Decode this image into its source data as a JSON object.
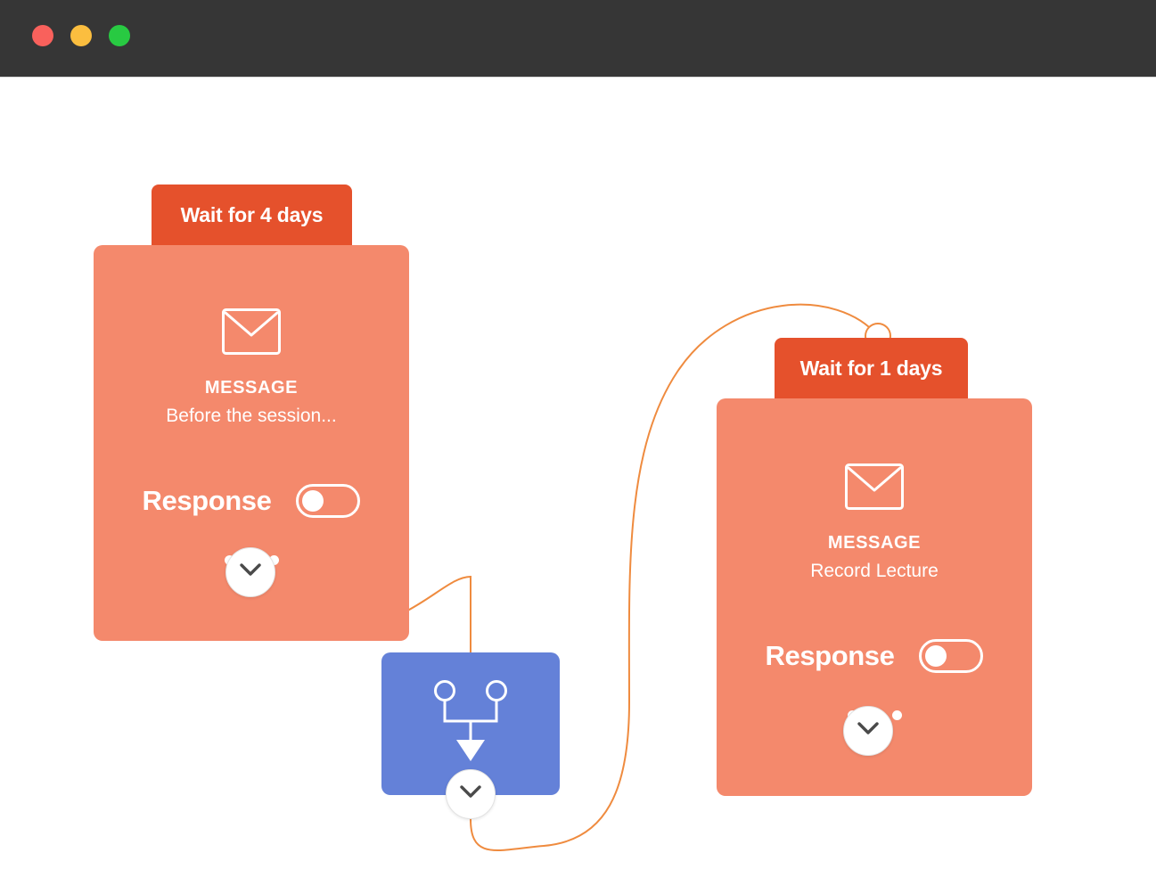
{
  "window": {
    "controls": [
      {
        "name": "close",
        "color": "#f9615c"
      },
      {
        "name": "minimize",
        "color": "#fbbe3f"
      },
      {
        "name": "maximize",
        "color": "#28ca42"
      }
    ]
  },
  "canvas": {
    "background": "#ffffff",
    "edge_color": "#ef8b3f"
  },
  "theme": {
    "header_orange": "#e5512c",
    "body_salmon": "#f4896c",
    "merge_blue": "#6481d8",
    "titlebar": "#363636"
  },
  "nodes": [
    {
      "id": "message-1",
      "type": "message",
      "header_label": "Wait for 4 days",
      "kind_label": "MESSAGE",
      "title": "Before the session...",
      "icon": "envelope-icon",
      "response": {
        "label": "Response",
        "enabled": false
      },
      "overflow_dots": 3,
      "expander_icon": "chevron-down-icon"
    },
    {
      "id": "merge-1",
      "type": "merge",
      "icon": "merge-branches-icon",
      "expander_icon": "chevron-down-icon"
    },
    {
      "id": "message-2",
      "type": "message",
      "header_label": "Wait for 1 days",
      "kind_label": "MESSAGE",
      "title": "Record Lecture",
      "icon": "envelope-icon",
      "response": {
        "label": "Response",
        "enabled": false
      },
      "overflow_dots": 3,
      "expander_icon": "chevron-down-icon",
      "has_inbound_port": true
    }
  ]
}
